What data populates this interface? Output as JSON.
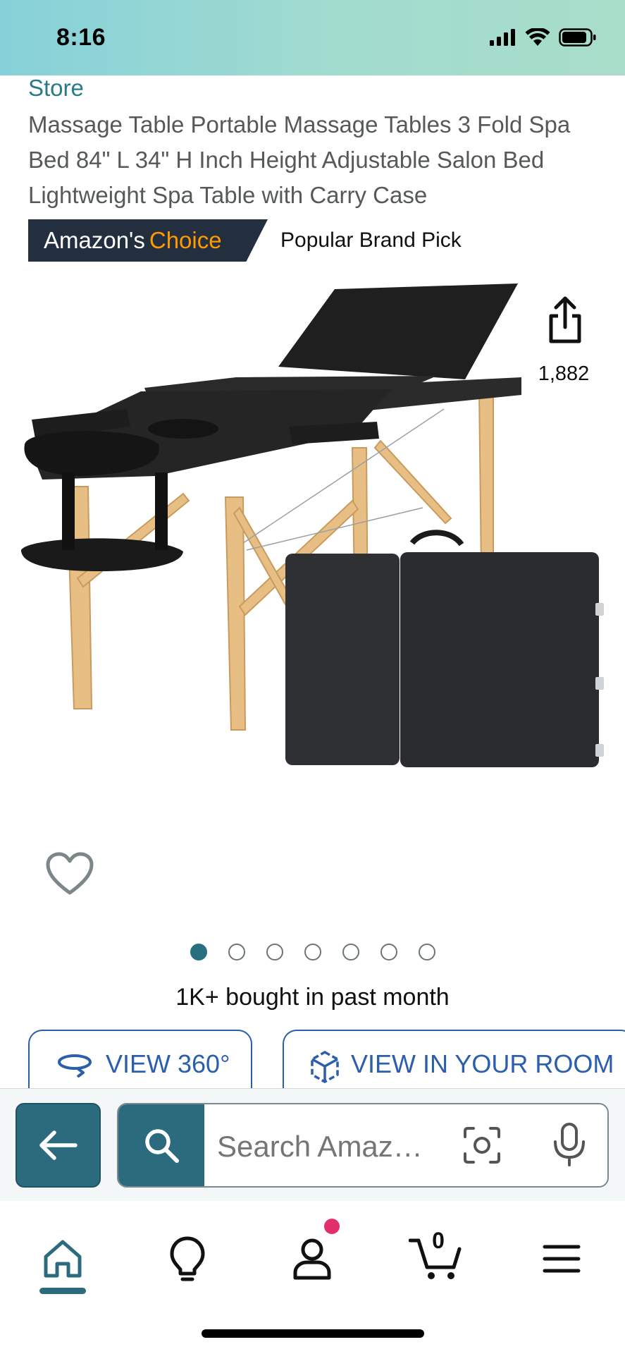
{
  "status_bar": {
    "time": "8:16"
  },
  "product": {
    "store_link": "Store",
    "title": "Massage Table Portable Massage Tables 3 Fold Spa Bed 84\" L 34\" H Inch Height Adjustable Salon Bed Lightweight Spa Table with Carry Case",
    "badge": {
      "prefix": "Amazon's",
      "highlight": "Choice",
      "description": "Popular Brand Pick"
    },
    "share_count": "1,882",
    "carousel": {
      "total_images": 7,
      "active_index": 0
    },
    "bought_text": "1K+ bought in past month",
    "view_360_label": "VIEW 360°",
    "view_in_room_label": "VIEW IN YOUR ROOM"
  },
  "search": {
    "placeholder": "Search Amaz…"
  },
  "bottom_nav": {
    "items": [
      {
        "name": "home",
        "icon": "home-icon",
        "active": true
      },
      {
        "name": "inspire",
        "icon": "lightbulb-icon"
      },
      {
        "name": "account",
        "icon": "person-icon",
        "has_notification": true
      },
      {
        "name": "cart",
        "icon": "cart-icon"
      },
      {
        "name": "menu",
        "icon": "hamburger-icon"
      }
    ],
    "cart_count": "0"
  },
  "colors": {
    "accent_teal": "#2c6b7e",
    "link_blue": "#2b5fad",
    "badge_bg": "#232f3e",
    "badge_choice": "#ff9900",
    "notification": "#e3306c"
  }
}
